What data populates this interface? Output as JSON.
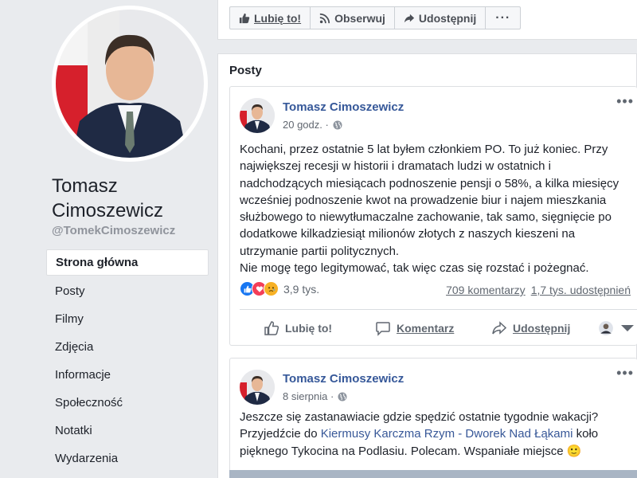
{
  "profile": {
    "name": "Tomasz Cimoszewicz",
    "handle": "@TomekCimoszewicz"
  },
  "nav": [
    {
      "label": "Strona główna"
    },
    {
      "label": "Posty"
    },
    {
      "label": "Filmy"
    },
    {
      "label": "Zdjęcia"
    },
    {
      "label": "Informacje"
    },
    {
      "label": "Społeczność"
    },
    {
      "label": "Notatki"
    },
    {
      "label": "Wydarzenia"
    }
  ],
  "toolbar": {
    "like": "Lubię to!",
    "follow": "Obserwuj",
    "share": "Udostępnij",
    "more": "···"
  },
  "posts_title": "Posty",
  "posts": [
    {
      "author": "Tomasz Cimoszewicz",
      "time": "20 godz. ·",
      "text": "Kochani, przez ostatnie 5 lat byłem członkiem PO. To już koniec. Przy największej recesji w historii i dramatach ludzi w ostatnich i nadchodzących miesiącach podnoszenie pensji o 58%, a kilka miesięcy wcześniej podnoszenie kwot na prowadzenie biur i najem mieszkania służbowego to niewytłumaczalne zachowanie, tak samo, sięgnięcie po dodatkowe kilkadziesiąt milionów złotych z naszych kieszeni na utrzymanie partii politycznych.",
      "text2": "Nie mogę tego legitymować, tak więc czas się rozstać i pożegnać.",
      "reactions_count": "3,9 tys.",
      "comments": "709 komentarzy",
      "shares": "1,7 tys. udostępnień",
      "actions": {
        "like": "Lubię to!",
        "comment": "Komentarz",
        "share": "Udostępnij"
      }
    },
    {
      "author": "Tomasz Cimoszewicz",
      "time": "8 sierpnia ·",
      "text_a": "Jeszcze się zastanawiacie gdzie spędzić ostatnie tygodnie wakacji? Przyjedźcie do ",
      "link": "Kiermusy Karczma Rzym - Dworek Nad Łąkami",
      "text_b": " koło pięknego Tykocina na Podlasiu. Polecam. Wspaniałe miejsce 🙂"
    }
  ],
  "colors": {
    "accent": "#365899",
    "background": "#e9ebee",
    "like_blue": "#1877f2",
    "love_red": "#f33e58",
    "sad_yellow": "#f7b125"
  }
}
